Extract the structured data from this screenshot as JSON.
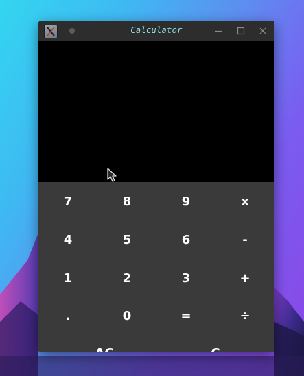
{
  "window": {
    "title": "Calculator"
  },
  "display": {
    "value": ""
  },
  "keypad": {
    "row1": [
      "7",
      "8",
      "9",
      "x"
    ],
    "row2": [
      "4",
      "5",
      "6",
      "-"
    ],
    "row3": [
      "1",
      "2",
      "3",
      "+"
    ],
    "row4": [
      ".",
      "0",
      "=",
      "÷"
    ],
    "row5": [
      "AC",
      "C"
    ]
  },
  "colors": {
    "display_bg": "#000000",
    "keypad_bg": "#3a3a3a",
    "titlebar_bg": "#2d2d2d",
    "title_text": "#8fe0e6",
    "key_text": "#ffffff"
  },
  "icons": {
    "app": "calculator-app-icon",
    "keep_above": "dot-icon",
    "minimize": "minimize-icon",
    "maximize": "maximize-icon",
    "close": "close-icon",
    "pointer": "mouse-pointer-icon"
  }
}
